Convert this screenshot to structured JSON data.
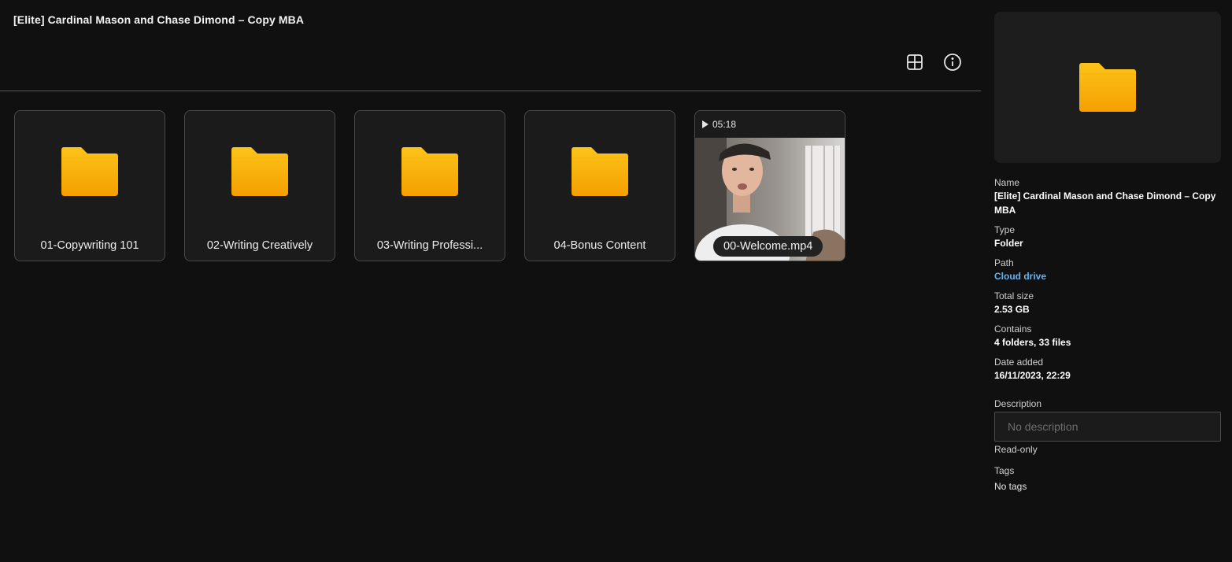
{
  "header": {
    "title": "[Elite] Cardinal Mason and Chase Dimond – Copy MBA",
    "grid_view_icon": "grid-view-icon",
    "info_icon": "info-icon"
  },
  "items": [
    {
      "type": "folder",
      "name": "01-Copywriting 101",
      "icon": "folder-icon"
    },
    {
      "type": "folder",
      "name": "02-Writing Creatively",
      "icon": "folder-icon"
    },
    {
      "type": "folder",
      "name": "03-Writing Professi...",
      "icon": "folder-icon"
    },
    {
      "type": "folder",
      "name": "04-Bonus Content",
      "icon": "folder-icon"
    },
    {
      "type": "video",
      "name": "00-Welcome.mp4",
      "duration": "05:18",
      "icon": "play-icon"
    }
  ],
  "details": {
    "name_label": "Name",
    "name_value": "[Elite] Cardinal Mason and Chase Dimond – Copy MBA",
    "type_label": "Type",
    "type_value": "Folder",
    "path_label": "Path",
    "path_value": "Cloud drive",
    "size_label": "Total size",
    "size_value": "2.53 GB",
    "contains_label": "Contains",
    "contains_value": "4 folders, 33 files",
    "date_label": "Date added",
    "date_value": "16/11/2023, 22:29",
    "description_label": "Description",
    "description_placeholder": "No description",
    "readonly_text": "Read-only",
    "tags_label": "Tags",
    "tags_value": "No tags"
  },
  "colors": {
    "background": "#101010",
    "folder_top": "#fcc419",
    "folder_bottom": "#f59f00",
    "link": "#64b4f0"
  }
}
